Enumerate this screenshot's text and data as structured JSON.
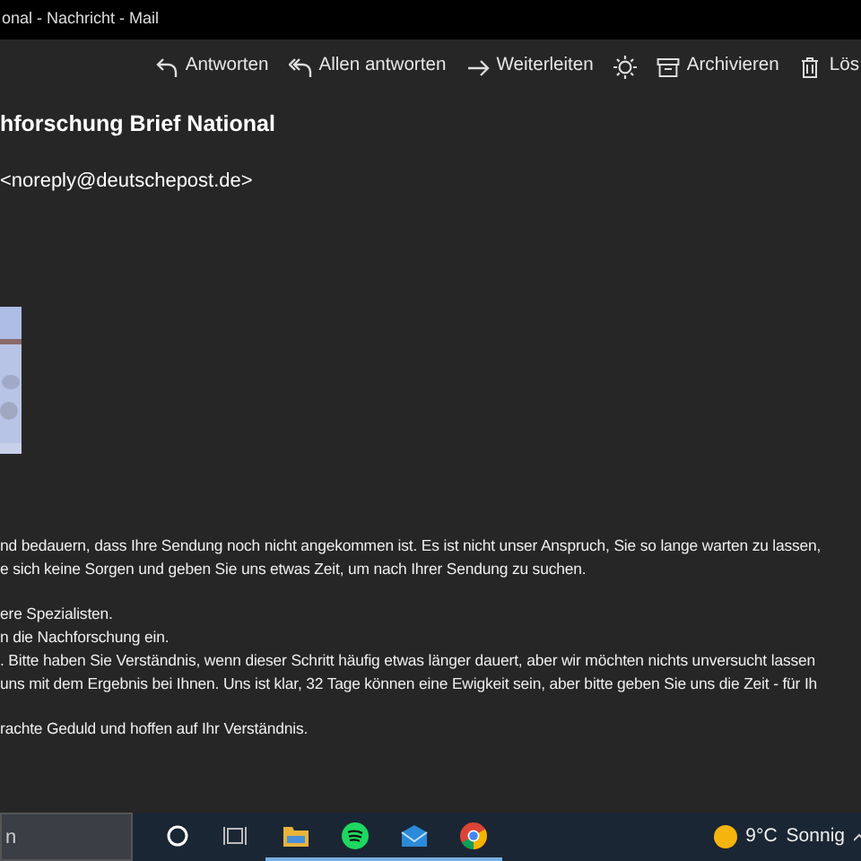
{
  "window": {
    "title": "onal - Nachricht - Mail"
  },
  "toolbar": [
    {
      "kind": "reply",
      "label": "Antworten"
    },
    {
      "kind": "reply-all",
      "label": "Allen antworten"
    },
    {
      "kind": "forward",
      "label": "Weiterleiten"
    },
    {
      "kind": "theme"
    },
    {
      "kind": "archive",
      "label": "Archivieren"
    },
    {
      "kind": "delete",
      "label": "Lös"
    }
  ],
  "message": {
    "subject": "hforschung Brief National",
    "sender": "<noreply@deutschepost.de>",
    "attachment": {
      "kind": "picture"
    },
    "paragraphs": [
      [
        "nd bedauern, dass Ihre Sendung noch nicht angekommen ist. Es ist nicht unser Anspruch, Sie so lange warten zu lassen,",
        "e sich keine Sorgen und geben Sie uns etwas Zeit, um nach Ihrer Sendung zu suchen."
      ],
      [
        "ere Spezialisten.",
        "n die Nachforschung ein.",
        ". Bitte haben Sie Verständnis, wenn dieser Schritt häufig etwas länger dauert, aber wir möchten nichts unversucht lassen",
        "uns mit dem Ergebnis bei Ihnen. Uns ist klar, 32 Tage können eine Ewigkeit sein, aber bitte geben Sie uns die Zeit - für Ih"
      ],
      [
        "rachte Geduld und hoffen auf Ihr Verständnis."
      ]
    ]
  },
  "taskbar": {
    "search": {
      "placeholder": "n"
    },
    "apps": [
      {
        "kind": "cortana",
        "active": false
      },
      {
        "kind": "taskview",
        "active": false
      },
      {
        "kind": "explorer",
        "active": true
      },
      {
        "kind": "spotify",
        "active": true
      },
      {
        "kind": "mail",
        "active": true
      },
      {
        "kind": "chrome",
        "active": true
      }
    ],
    "weather": {
      "temperature": "9°C",
      "condition": "Sonnig"
    }
  }
}
